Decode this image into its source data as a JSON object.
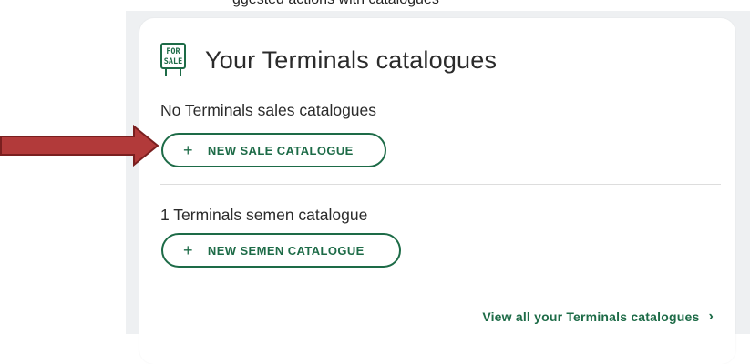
{
  "page": {
    "top_cut_text": "ggested actions with catalogues"
  },
  "card": {
    "icon": "for-sale-sign-icon",
    "icon_text": {
      "line1": "FOR",
      "line2": "SALE"
    },
    "title": "Your Terminals catalogues",
    "sales": {
      "status_text": "No Terminals sales catalogues",
      "button_label": "NEW SALE CATALOGUE",
      "button_icon": "plus-icon"
    },
    "semen": {
      "status_text": "1 Terminals semen catalogue",
      "button_label": "NEW SEMEN CATALOGUE",
      "button_icon": "plus-icon"
    },
    "view_all_link": "View all your Terminals catalogues",
    "view_all_icon": "chevron-right-icon"
  },
  "annotation": {
    "icon": "red-arrow-icon"
  },
  "colors": {
    "brand_green": "#1d6b47",
    "arrow_fill": "#b23a3a",
    "arrow_stroke": "#7a1f1f",
    "page_background": "#eef0f2"
  }
}
